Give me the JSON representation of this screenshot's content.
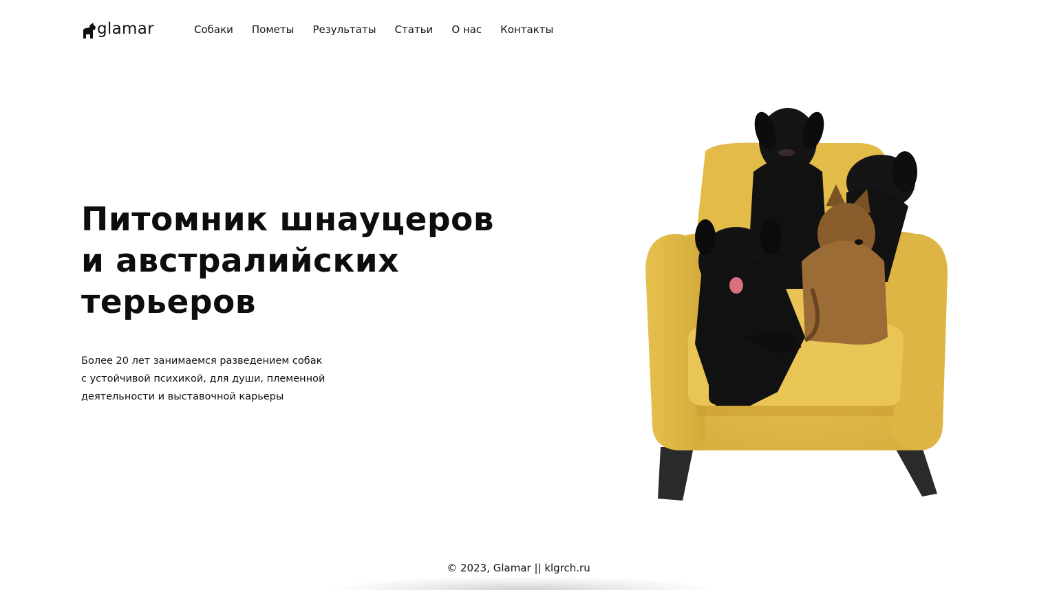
{
  "header": {
    "logo_text": "glamar",
    "logo_icon": "dog-icon",
    "nav": [
      {
        "label": "Собаки"
      },
      {
        "label": "Пометы"
      },
      {
        "label": "Результаты"
      },
      {
        "label": "Статьи"
      },
      {
        "label": "О нас"
      },
      {
        "label": "Контакты"
      }
    ]
  },
  "hero": {
    "title_line1": "Питомник шнауцеров",
    "title_line2": "и австралийских",
    "title_line3": "терьеров",
    "desc_line1": "Более 20 лет занимаемся разведением собак",
    "desc_line2": "с устойчивой психикой, для души, племенной",
    "desc_line3": "деятельности и выставочной карьеры"
  },
  "footer": {
    "text": "© 2023, Glamar || klgrch.ru"
  },
  "colors": {
    "armchair": "#e3bd4a",
    "armchair_shade": "#c9a23a",
    "dog_black": "#121212",
    "yorkie_tan": "#9a6a35",
    "text": "#111111"
  }
}
